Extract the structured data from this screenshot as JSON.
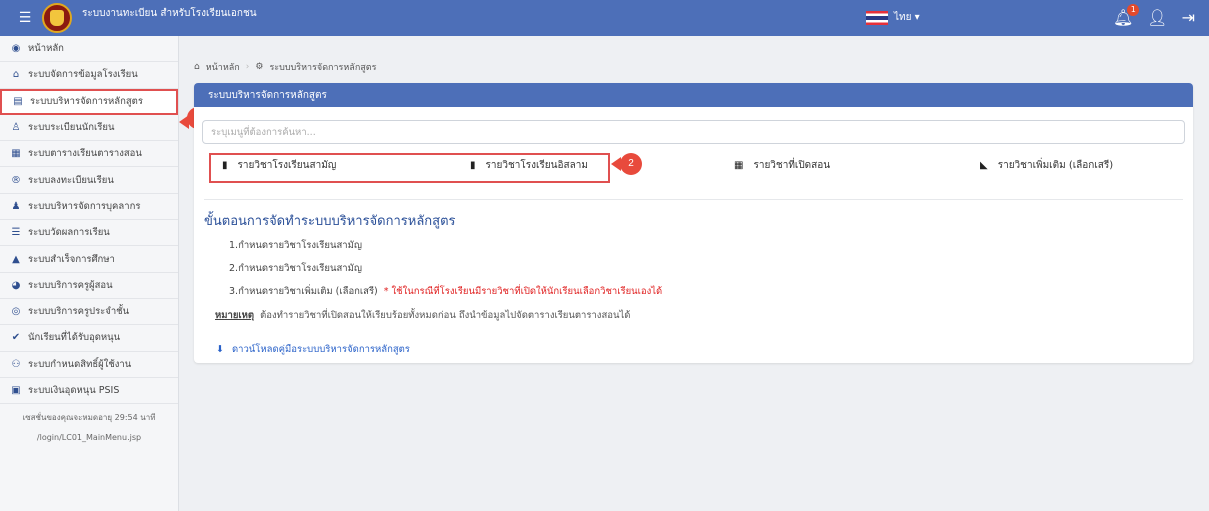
{
  "header": {
    "app_title": "ระบบงานทะเบียน สำหรับโรงเรียนเอกชน",
    "language": "ไทย ▾",
    "notification_count": "1"
  },
  "sidebar": {
    "items": [
      {
        "label": "หน้าหลัก"
      },
      {
        "label": "ระบบจัดการข้อมูลโรงเรียน"
      },
      {
        "label": "ระบบบริหารจัดการหลักสูตร"
      },
      {
        "label": "ระบบระเบียนนักเรียน"
      },
      {
        "label": "ระบบตารางเรียนตารางสอน"
      },
      {
        "label": "ระบบลงทะเบียนเรียน"
      },
      {
        "label": "ระบบบริหารจัดการบุคลากร"
      },
      {
        "label": "ระบบวัดผลการเรียน"
      },
      {
        "label": "ระบบสำเร็จการศึกษา"
      },
      {
        "label": "ระบบบริการครูผู้สอน"
      },
      {
        "label": "ระบบบริการครูประจำชั้น"
      },
      {
        "label": "นักเรียนที่ได้รับอุดหนุน"
      },
      {
        "label": "ระบบกำหนดสิทธิ์ผู้ใช้งาน"
      },
      {
        "label": "ระบบเงินอุดหนุน PSIS"
      }
    ],
    "session_text": "เซสชั่นของคุณจะหมดอายุ 29:54 นาที",
    "path_text": "/login/LC01_MainMenu.jsp"
  },
  "annotations": {
    "marker1": "1",
    "marker2": "2"
  },
  "breadcrumb": {
    "home": "หน้าหลัก",
    "current": "ระบบบริหารจัดการหลักสูตร"
  },
  "panel": {
    "title": "ระบบบริหารจัดการหลักสูตร",
    "search_placeholder": "ระบุเมนูที่ต้องการค้นหา...",
    "tabs": [
      {
        "label": "รายวิชาโรงเรียนสามัญ"
      },
      {
        "label": "รายวิชาโรงเรียนอิสลาม"
      },
      {
        "label": "รายวิชาที่เปิดสอน"
      },
      {
        "label": "รายวิชาเพิ่มเติม (เลือกเสรี)"
      }
    ],
    "steps_title": "ขั้นตอนการจัดทำระบบบริหารจัดการหลักสูตร",
    "steps": [
      {
        "text": "1.กำหนดรายวิชาโรงเรียนสามัญ"
      },
      {
        "text": "2.กำหนดรายวิชาโรงเรียนสามัญ"
      },
      {
        "text": "3.กำหนดรายวิชาเพิ่มเติม (เลือกเสรี)",
        "warning": "* ใช้ในกรณีที่โรงเรียนมีรายวิชาที่เปิดให้นักเรียนเลือกวิชาเรียนเองได้"
      }
    ],
    "note_label": "หมายเหตุ",
    "note_text": "ต้องทำรายวิชาที่เปิดสอนให้เรียบร้อยทั้งหมดก่อน ถึงนำข้อมูลไปจัดตารางเรียนตารางสอนได้",
    "download_label": "ดาวน์โหลดคู่มือระบบบริหารจัดการหลักสูตร"
  },
  "colors": {
    "primary": "#4d6fb8",
    "highlight": "#e05050",
    "marker": "#e84a3c",
    "warning": "#e02020",
    "link": "#2a62c9"
  }
}
